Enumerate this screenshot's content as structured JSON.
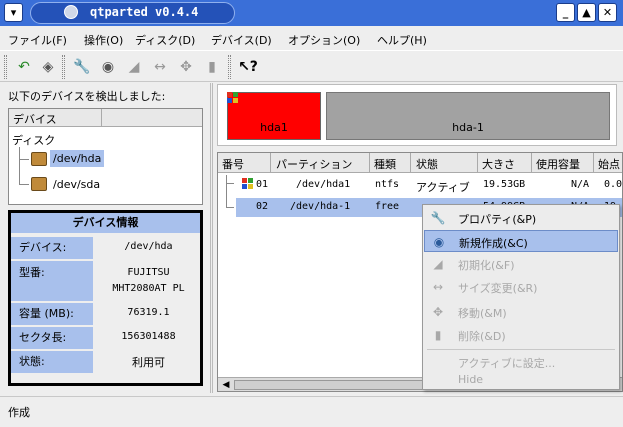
{
  "window": {
    "title": "qtparted v0.4.4"
  },
  "menu": [
    "ファイル(F)",
    "操作(O)",
    "ディスク(D)",
    "デバイス(D)",
    "オプション(O)",
    "ヘルプ(H)"
  ],
  "left": {
    "detected_label": "以下のデバイスを検出しました:",
    "tree_header": "デバイス",
    "tree_root": "ディスク",
    "devices": [
      "/dev/hda",
      "/dev/sda"
    ],
    "info": {
      "title": "デバイス情報",
      "rows": [
        {
          "label": "デバイス:",
          "value": "/dev/hda"
        },
        {
          "label": "型番:",
          "value": "FUJITSU\nMHT2080AT PL"
        },
        {
          "label": "容量 (MB):",
          "value": "76319.1"
        },
        {
          "label": "セクタ長:",
          "value": "156301488"
        },
        {
          "label": "状態:",
          "value": "利用可"
        }
      ]
    }
  },
  "partitions_map": {
    "p1_label": "hda1",
    "p2_label": "hda-1",
    "p1_color": "#ff0000",
    "p2_color": "#a2a2a2"
  },
  "table": {
    "headers": [
      "番号",
      "パーティション",
      "種類",
      "状態",
      "大きさ",
      "使用容量",
      "始点"
    ],
    "rows": [
      {
        "num": "01",
        "part": "/dev/hda1",
        "type": "ntfs",
        "state": "アクティブ",
        "size": "19.53GB",
        "used": "N/A",
        "start": "0.0"
      },
      {
        "num": "02",
        "part": "/dev/hda-1",
        "type": "free",
        "state": "",
        "size": "54.99GB",
        "used": "N/A",
        "start": "19.5"
      }
    ]
  },
  "context_menu": {
    "items": [
      {
        "label": "プロパティ(&P)",
        "icon": "wrench-icon",
        "enabled": true
      },
      {
        "label": "新規作成(&C)",
        "icon": "new-disk-icon",
        "enabled": true,
        "highlighted": true
      },
      {
        "label": "初期化(&F)",
        "icon": "eraser-icon",
        "enabled": false
      },
      {
        "label": "サイズ変更(&R)",
        "icon": "resize-arrows-icon",
        "enabled": false
      },
      {
        "label": "移動(&M)",
        "icon": "move-arrows-icon",
        "enabled": false
      },
      {
        "label": "削除(&D)",
        "icon": "trash-icon",
        "enabled": false
      },
      {
        "label": "アクティブに設定...",
        "icon": "",
        "enabled": false
      },
      {
        "label": "Hide",
        "icon": "",
        "enabled": false
      }
    ]
  },
  "status": {
    "text": "作成"
  },
  "colors": {
    "titlebar": "#3a6fd8",
    "selection": "#a8c0ec"
  }
}
